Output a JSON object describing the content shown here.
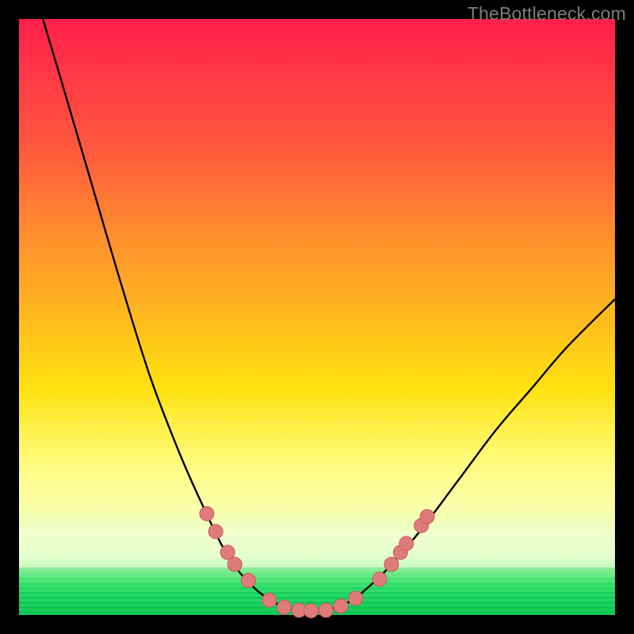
{
  "watermark": "TheBottleneck.com",
  "colors": {
    "frame": "#000000",
    "gradient_top": "#ff1f4b",
    "gradient_bottom": "#12c95c",
    "curve": "#000000",
    "dot_fill": "#e07b7b",
    "dot_stroke": "#c85a5a"
  },
  "chart_data": {
    "type": "line",
    "title": "",
    "xlabel": "",
    "ylabel": "",
    "xlim": [
      0,
      100
    ],
    "ylim": [
      0,
      100
    ],
    "curve": [
      {
        "x": 4,
        "y": 100
      },
      {
        "x": 7,
        "y": 90
      },
      {
        "x": 12,
        "y": 73
      },
      {
        "x": 17,
        "y": 56
      },
      {
        "x": 22,
        "y": 40
      },
      {
        "x": 27,
        "y": 27
      },
      {
        "x": 31,
        "y": 18
      },
      {
        "x": 35,
        "y": 10
      },
      {
        "x": 39,
        "y": 5
      },
      {
        "x": 43,
        "y": 2
      },
      {
        "x": 47,
        "y": 0.8
      },
      {
        "x": 51,
        "y": 0.8
      },
      {
        "x": 55,
        "y": 2
      },
      {
        "x": 59,
        "y": 5
      },
      {
        "x": 63,
        "y": 9
      },
      {
        "x": 68,
        "y": 15
      },
      {
        "x": 74,
        "y": 23
      },
      {
        "x": 80,
        "y": 31
      },
      {
        "x": 86,
        "y": 38
      },
      {
        "x": 92,
        "y": 45
      },
      {
        "x": 100,
        "y": 53
      }
    ],
    "dots": [
      {
        "x": 31.5,
        "y": 17.0
      },
      {
        "x": 33.0,
        "y": 14.0
      },
      {
        "x": 35.0,
        "y": 10.5
      },
      {
        "x": 36.2,
        "y": 8.5
      },
      {
        "x": 38.5,
        "y": 5.8
      },
      {
        "x": 42.0,
        "y": 2.5
      },
      {
        "x": 44.5,
        "y": 1.3
      },
      {
        "x": 47.0,
        "y": 0.8
      },
      {
        "x": 49.0,
        "y": 0.7
      },
      {
        "x": 51.5,
        "y": 0.8
      },
      {
        "x": 54.0,
        "y": 1.5
      },
      {
        "x": 56.5,
        "y": 2.8
      },
      {
        "x": 60.5,
        "y": 6.0
      },
      {
        "x": 62.5,
        "y": 8.5
      },
      {
        "x": 64.0,
        "y": 10.5
      },
      {
        "x": 65.0,
        "y": 12.0
      },
      {
        "x": 67.5,
        "y": 15.0
      },
      {
        "x": 68.5,
        "y": 16.5
      }
    ],
    "annotations": []
  }
}
